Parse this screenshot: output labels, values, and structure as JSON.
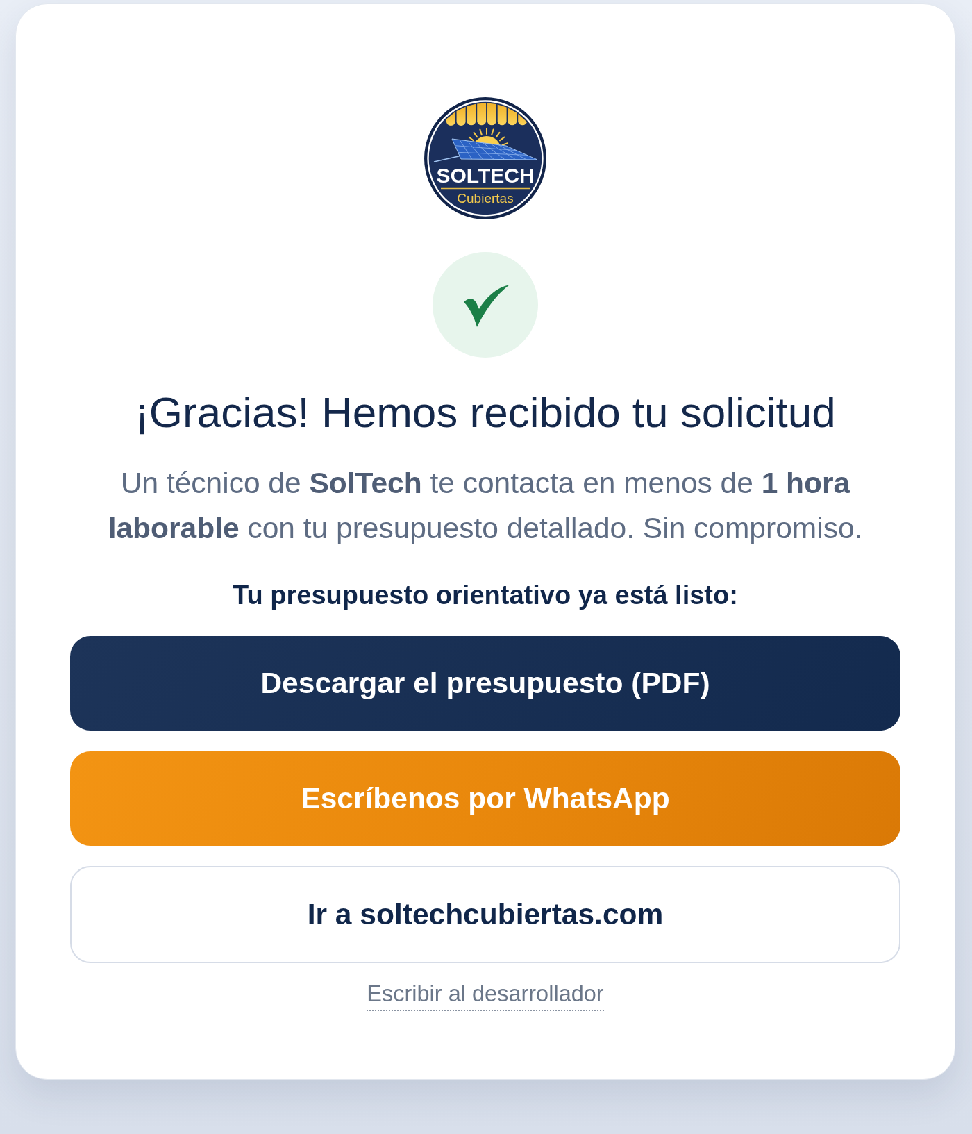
{
  "logo": {
    "wordmark": "SOLTECH",
    "tagline": "Cubiertas"
  },
  "confirmation": {
    "title": "¡Gracias! Hemos recibido tu solicitud",
    "message": "Un técnico de **SolTech** te contacta en menos de **1 hora laborable** con tu presupuesto detallado. Sin compromiso."
  },
  "quote": {
    "label": "Tu presupuesto orientativo ya está listo:",
    "buttons": [
      {
        "kind": "primary",
        "label": "Descargar el presupuesto (PDF)"
      },
      {
        "kind": "whatsapp",
        "label": "Escríbenos por WhatsApp"
      },
      {
        "kind": "outline",
        "label": "Ir a soltechcubiertas.com"
      }
    ]
  },
  "developer_link": "Escribir al desarrollador"
}
